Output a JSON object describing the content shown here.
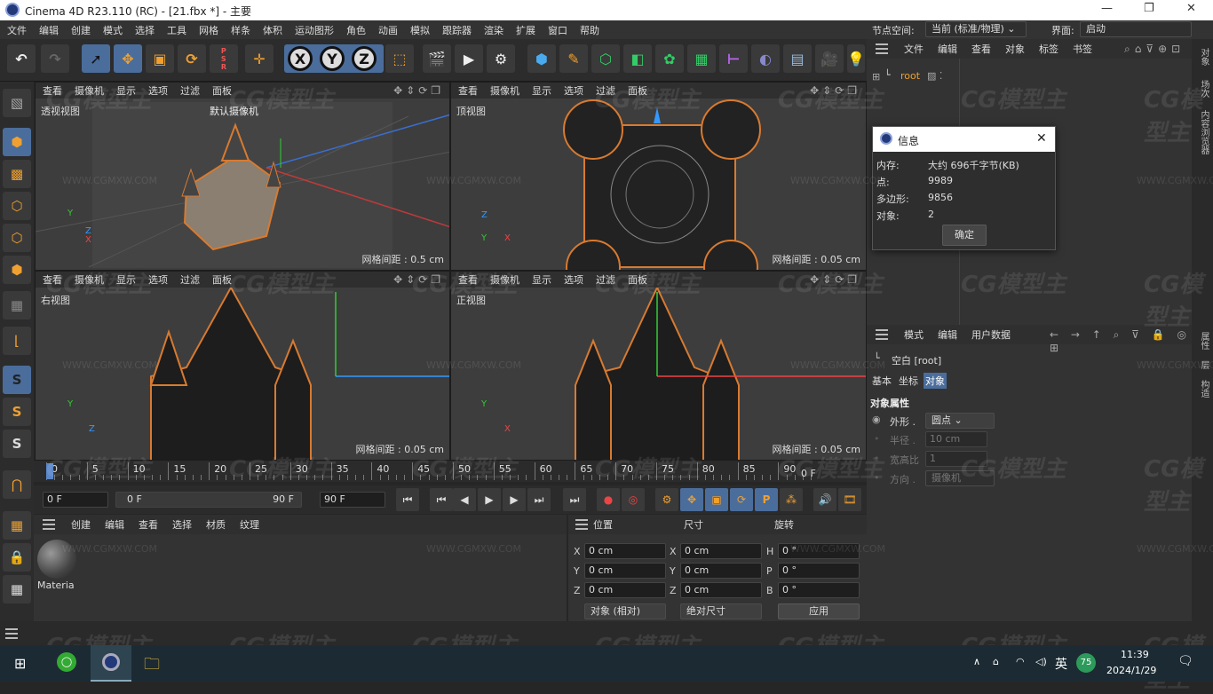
{
  "title": "Cinema 4D R23.110 (RC) - [21.fbx *] - 主要",
  "window_controls": {
    "minimize": "—",
    "maximize": "❐",
    "close": "✕"
  },
  "menu": [
    "文件",
    "编辑",
    "创建",
    "模式",
    "选择",
    "工具",
    "网格",
    "样条",
    "体积",
    "运动图形",
    "角色",
    "动画",
    "模拟",
    "跟踪器",
    "渲染",
    "扩展",
    "窗口",
    "帮助"
  ],
  "node_space_label": "节点空间:",
  "node_space_value": "当前 (标准/物理)",
  "interface_label": "界面:",
  "interface_value": "启动",
  "toolbar": {
    "x": "X",
    "y": "Y",
    "z": "Z"
  },
  "viewports": {
    "perspective": {
      "menu": [
        "查看",
        "摄像机",
        "显示",
        "选项",
        "过滤",
        "面板"
      ],
      "name": "透视视图",
      "camera": "默认摄像机",
      "grid": "网格间距 : 0.5 cm"
    },
    "top": {
      "menu": [
        "查看",
        "摄像机",
        "显示",
        "选项",
        "过滤",
        "面板"
      ],
      "name": "顶视图",
      "grid": "网格间距 : 0.05 cm"
    },
    "right": {
      "menu": [
        "查看",
        "摄像机",
        "显示",
        "选项",
        "过滤",
        "面板"
      ],
      "name": "右视图",
      "grid": "网格间距 : 0.05 cm"
    },
    "front": {
      "menu": [
        "查看",
        "摄像机",
        "显示",
        "选项",
        "过滤",
        "面板"
      ],
      "name": "正视图",
      "grid": "网格间距 : 0.05 cm"
    }
  },
  "timeline": {
    "ticks": [
      "0",
      "5",
      "10",
      "15",
      "20",
      "25",
      "30",
      "35",
      "40",
      "45",
      "50",
      "55",
      "60",
      "65",
      "70",
      "75",
      "80",
      "85",
      "90"
    ],
    "current_frame": "0 F"
  },
  "playback": {
    "start": "0 F",
    "range_start": "0 F",
    "range_end": "90 F",
    "end": "90 F"
  },
  "material_manager": {
    "menu": [
      "创建",
      "编辑",
      "查看",
      "选择",
      "材质",
      "纹理"
    ],
    "material_name": "Materia"
  },
  "coordinates": {
    "headers": [
      "位置",
      "尺寸",
      "旋转"
    ],
    "pos": [
      {
        "axis": "X",
        "value": "0 cm"
      },
      {
        "axis": "Y",
        "value": "0 cm"
      },
      {
        "axis": "Z",
        "value": "0 cm"
      }
    ],
    "size": [
      {
        "axis": "X",
        "value": "0 cm"
      },
      {
        "axis": "Y",
        "value": "0 cm"
      },
      {
        "axis": "Z",
        "value": "0 cm"
      }
    ],
    "rot": [
      {
        "axis": "H",
        "value": "0 °"
      },
      {
        "axis": "P",
        "value": "0 °"
      },
      {
        "axis": "B",
        "value": "0 °"
      }
    ],
    "mode": "对象 (相对)",
    "size_mode": "绝对尺寸",
    "apply": "应用"
  },
  "object_manager": {
    "menu": [
      "文件",
      "编辑",
      "查看",
      "对象",
      "标签",
      "书签"
    ],
    "root": "root"
  },
  "info_dialog": {
    "title": "信息",
    "rows": [
      {
        "label": "内存:",
        "value": "大约 696千字节(KB)"
      },
      {
        "label": "点:",
        "value": "9989"
      },
      {
        "label": "多边形:",
        "value": "9856"
      },
      {
        "label": "对象:",
        "value": "2"
      }
    ],
    "ok": "确定"
  },
  "attribute_manager": {
    "menu": [
      "模式",
      "编辑",
      "用户数据"
    ],
    "object": "空白 [root]",
    "tabs": [
      "基本",
      "坐标",
      "对象"
    ],
    "section": "对象属性",
    "props": [
      {
        "label": "外形 .",
        "value": "圆点",
        "enabled": true
      },
      {
        "label": "半径 .",
        "value": "10 cm",
        "enabled": false
      },
      {
        "label": "宽高比",
        "value": "1",
        "enabled": false
      },
      {
        "label": "方向 .",
        "value": "摄像机",
        "enabled": false
      }
    ]
  },
  "right_strip": [
    "对象",
    "场次",
    "内容浏览器",
    "属性",
    "层",
    "构造"
  ],
  "taskbar": {
    "lang": "英",
    "badge": "75",
    "time": "11:39",
    "date": "2024/1/29"
  },
  "watermark": {
    "logo": "CG模型主",
    "url": "WWW.CGMXW.COM"
  }
}
